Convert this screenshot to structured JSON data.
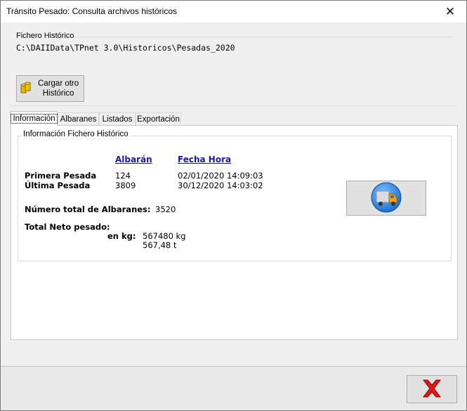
{
  "window": {
    "title": "Tránsito Pesado: Consulta archivos históricos",
    "close_glyph": "✕"
  },
  "file_group": {
    "label": "Fichero Histórico",
    "path": "C:\\DAIIData\\TPnet 3.0\\Historicos\\Pesadas_2020"
  },
  "load_button": {
    "line1": "Cargar otro",
    "line2": "Histórico",
    "icon": "database-icon"
  },
  "tabs": [
    {
      "label": "Información",
      "active": true
    },
    {
      "label": "Albaranes",
      "active": false
    },
    {
      "label": "Listados",
      "active": false
    },
    {
      "label": "Exportación",
      "active": false
    }
  ],
  "info": {
    "group_label": "Información Fichero Histórico",
    "col_albaran": "Albarán",
    "col_fecha": "Fecha Hora",
    "first_label": "Primera Pesada",
    "first_albaran": "124",
    "first_fecha": "02/01/2020 14:09:03",
    "last_label": "Última Pesada",
    "last_albaran": "3809",
    "last_fecha": "30/12/2020 14:03:02",
    "total_albaranes_label": "Número total de Albaranes:",
    "total_albaranes_value": "3520",
    "neto_label": "Total Neto pesado:",
    "en_kg_label": "en kg:",
    "neto_kg": "567480 kg",
    "neto_t": "567,48 t"
  },
  "truck_button": {
    "icon": "truck-icon"
  },
  "cancel_button": {
    "icon": "red-x-icon"
  },
  "colors": {
    "link_header": "#1a1aa0",
    "truck_circle": "#1e6fd0",
    "truck_cab": "#f2a400",
    "cancel_x": "#e01818"
  }
}
